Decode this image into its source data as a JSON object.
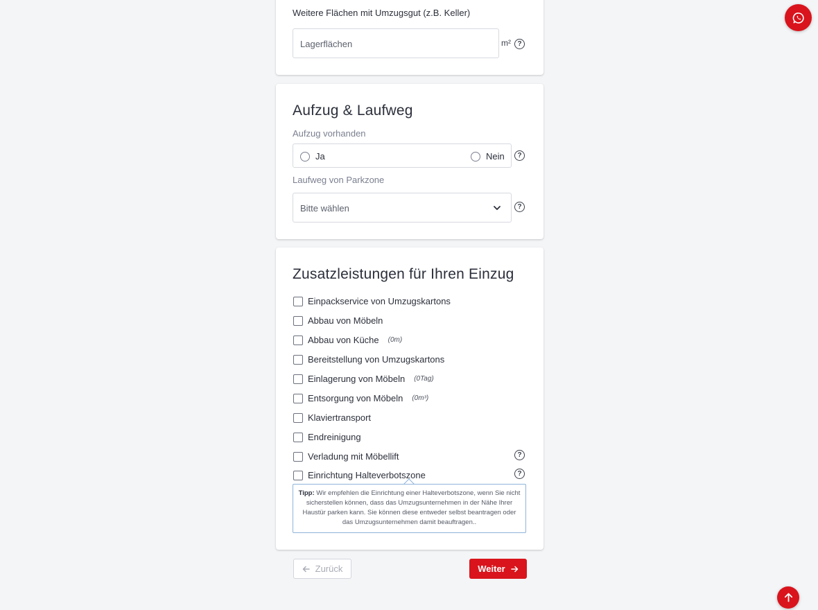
{
  "storage": {
    "label": "Weitere Flächen mit Umzugsgut (z.B. Keller)",
    "placeholder": "Lagerflächen",
    "unit": "m²"
  },
  "elevator_section": {
    "title": "Aufzug & Laufweg",
    "elevator_label": "Aufzug vorhanden",
    "yes_label": "Ja",
    "no_label": "Nein",
    "walkway_label": "Laufweg von Parkzone",
    "walkway_value": "Bitte wählen"
  },
  "extras": {
    "title": "Zusatzleistungen für Ihren Einzug",
    "items": [
      {
        "label": "Einpackservice von Umzugskartons",
        "hint": ""
      },
      {
        "label": "Abbau von Möbeln",
        "hint": ""
      },
      {
        "label": "Abbau von Küche",
        "hint": "(0m)"
      },
      {
        "label": "Bereitstellung von Umzugskartons",
        "hint": ""
      },
      {
        "label": "Einlagerung von Möbeln",
        "hint": "(0Tag)"
      },
      {
        "label": "Entsorgung von Möbeln",
        "hint": "(0m³)"
      },
      {
        "label": "Klaviertransport",
        "hint": ""
      },
      {
        "label": "Endreinigung",
        "hint": ""
      },
      {
        "label": "Verladung mit Möbellift",
        "hint": ""
      },
      {
        "label": "Einrichtung Halteverbotszone",
        "hint": ""
      }
    ],
    "tip_prefix": "Tipp:",
    "tip_text": "Wir empfehlen die Einrichtung einer Halteverbotszone, wenn Sie nicht sicherstellen können, dass das Umzugsunternehmen in der Nähe Ihrer Haustür parken kann. Sie können diese entweder selbst beantragen oder das Umzugsunternehmen damit beauftragen.."
  },
  "nav": {
    "back_label": "Zurück",
    "next_label": "Weiter"
  },
  "icons": {
    "help": "?",
    "chevron": "chevron-down-icon",
    "whatsapp": "whatsapp-icon",
    "scroll_top": "arrow-up-icon"
  },
  "colors": {
    "accent": "#d9141c",
    "tip_border": "#8fb3d9"
  }
}
